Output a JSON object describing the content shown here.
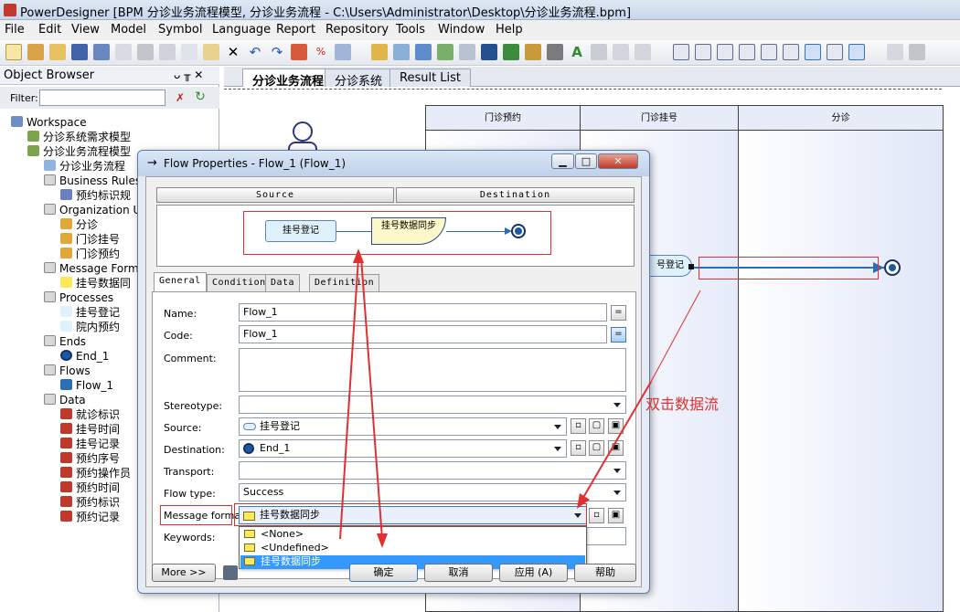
{
  "app": {
    "title": "PowerDesigner [BPM 分诊业务流程模型, 分诊业务流程 - C:\\Users\\Administrator\\Desktop\\分诊业务流程.bpm]"
  },
  "menu": [
    "File",
    "Edit",
    "View",
    "Model",
    "Symbol",
    "Language",
    "Report",
    "Repository",
    "Tools",
    "Window",
    "Help"
  ],
  "object_browser": {
    "title": "Object Browser",
    "pin": "ᴗ ╥ ✕",
    "filter_label": "Filter:",
    "tree": [
      {
        "label": "Workspace",
        "indent": 0,
        "icon": "workspace-icon"
      },
      {
        "label": "分诊系统需求模型",
        "indent": 1,
        "icon": "model-icon"
      },
      {
        "label": "分诊业务流程模型",
        "indent": 1,
        "icon": "model-icon"
      },
      {
        "label": "分诊业务流程",
        "indent": 2,
        "icon": "diagram-icon"
      },
      {
        "label": "Business Rules",
        "indent": 2,
        "icon": "folder-icon"
      },
      {
        "label": "预约标识规",
        "indent": 3,
        "icon": "rule-icon"
      },
      {
        "label": "Organization Unit",
        "indent": 2,
        "icon": "folder-icon"
      },
      {
        "label": "分诊",
        "indent": 3,
        "icon": "org-icon"
      },
      {
        "label": "门诊挂号",
        "indent": 3,
        "icon": "org-icon"
      },
      {
        "label": "门诊预约",
        "indent": 3,
        "icon": "org-icon"
      },
      {
        "label": "Message Formats",
        "indent": 2,
        "icon": "folder-icon"
      },
      {
        "label": "挂号数据同",
        "indent": 3,
        "icon": "message-icon"
      },
      {
        "label": "Processes",
        "indent": 2,
        "icon": "folder-icon"
      },
      {
        "label": "挂号登记",
        "indent": 3,
        "icon": "process-icon"
      },
      {
        "label": "院内预约",
        "indent": 3,
        "icon": "process-icon"
      },
      {
        "label": "Ends",
        "indent": 2,
        "icon": "folder-icon"
      },
      {
        "label": "End_1",
        "indent": 3,
        "icon": "end-icon"
      },
      {
        "label": "Flows",
        "indent": 2,
        "icon": "folder-icon"
      },
      {
        "label": "Flow_1",
        "indent": 3,
        "icon": "flow-icon"
      },
      {
        "label": "Data",
        "indent": 2,
        "icon": "folder-icon"
      },
      {
        "label": "就诊标识",
        "indent": 3,
        "icon": "data-icon"
      },
      {
        "label": "挂号时间",
        "indent": 3,
        "icon": "data-icon"
      },
      {
        "label": "挂号记录",
        "indent": 3,
        "icon": "data-icon"
      },
      {
        "label": "预约序号",
        "indent": 3,
        "icon": "data-icon"
      },
      {
        "label": "预约操作员",
        "indent": 3,
        "icon": "data-icon"
      },
      {
        "label": "预约时间",
        "indent": 3,
        "icon": "data-icon"
      },
      {
        "label": "预约标识",
        "indent": 3,
        "icon": "data-icon"
      },
      {
        "label": "预约记录",
        "indent": 3,
        "icon": "data-icon"
      }
    ]
  },
  "diagram_tabs": [
    "分诊业务流程",
    "分诊系统",
    "Result List"
  ],
  "canvas": {
    "lanes": [
      "门诊预约",
      "门诊挂号",
      "分诊"
    ],
    "process_partial": "号登记"
  },
  "dialog": {
    "title": "Flow Properties - Flow_1 (Flow_1)",
    "arrow": "→",
    "source_header": "Source",
    "destination_header": "Destination",
    "preview": {
      "source": "挂号登记",
      "message": "挂号数据同步"
    },
    "tabs": [
      "General",
      "Condition",
      "Data",
      "Definition"
    ],
    "fields": {
      "name_label": "Name:",
      "name_value": "Flow_1",
      "code_label": "Code:",
      "code_value": "Flow_1",
      "comment_label": "Comment:",
      "stereotype_label": "Stereotype:",
      "source_label": "Source:",
      "source_value": "挂号登记",
      "destination_label": "Destination:",
      "destination_value": "End_1",
      "transport_label": "Transport:",
      "flowtype_label": "Flow type:",
      "flowtype_value": "Success",
      "message_label": "Message format",
      "message_value": "挂号数据同步",
      "keywords_label": "Keywords:"
    },
    "eq_btn": "=",
    "dropdown_options": [
      "<None>",
      "<Undefined>",
      "挂号数据同步"
    ],
    "buttons": {
      "more": "More >>",
      "ok": "确定",
      "cancel": "取消",
      "apply": "应用 (A)",
      "help": "帮助"
    }
  },
  "annotation": {
    "text": "双击数据流",
    "color": "#e03030"
  }
}
